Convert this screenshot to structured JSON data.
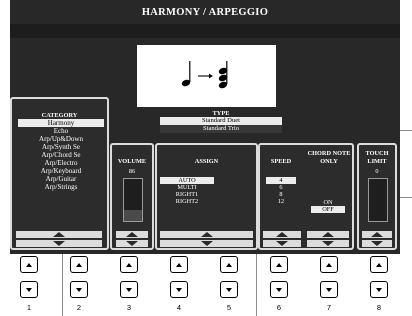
{
  "screen": {
    "title": "HARMONY / ARPEGGIO"
  },
  "category": {
    "header": "CATEGORY",
    "items": [
      {
        "label": "Harmony",
        "selected": true
      },
      {
        "label": "Echo",
        "selected": false
      },
      {
        "label": "Arp/Up&Down",
        "selected": false
      },
      {
        "label": "Arp/Synth Se",
        "selected": false
      },
      {
        "label": "Arp/Chord Se",
        "selected": false
      },
      {
        "label": "Arp/Electro",
        "selected": false
      },
      {
        "label": "Arp/Keyboard",
        "selected": false
      },
      {
        "label": "Arp/Guitar",
        "selected": false
      },
      {
        "label": "Arp/Strings",
        "selected": false
      }
    ]
  },
  "type": {
    "header": "TYPE",
    "items": [
      {
        "label": "Standard Duet",
        "selected": true
      },
      {
        "label": "Standard Trio",
        "selected": false
      }
    ]
  },
  "volume": {
    "header": "VOLUME",
    "value": "86",
    "level": 0.27
  },
  "assign": {
    "header": "ASSIGN",
    "options": [
      {
        "label": "AUTO",
        "selected": true
      },
      {
        "label": "MULTI",
        "selected": false
      },
      {
        "label": "RIGHT1",
        "selected": false
      },
      {
        "label": "RIGHT2",
        "selected": false
      }
    ]
  },
  "speed": {
    "header": "SPEED",
    "options": [
      {
        "label": "4",
        "selected": true
      },
      {
        "label": "6",
        "selected": false
      },
      {
        "label": "8",
        "selected": false
      },
      {
        "label": "12",
        "selected": false
      }
    ]
  },
  "chord_note_only": {
    "header_line1": "CHORD NOTE",
    "header_line2": "ONLY",
    "options": [
      {
        "label": "ON",
        "selected": false
      },
      {
        "label": "OFF",
        "selected": true
      }
    ]
  },
  "touch_limit": {
    "header_line1": "TOUCH",
    "header_line2": "LIMIT",
    "value": "0",
    "level": 0.0
  },
  "buttons": [
    "1",
    "2",
    "3",
    "4",
    "5",
    "6",
    "7",
    "8"
  ],
  "icons": {
    "note_change": "quarter-note-to-chord-icon",
    "up": "triangle-up-icon",
    "down": "triangle-down-icon"
  },
  "colors": {
    "screen_bg": "#282828",
    "panel_border": "#dcdcdc",
    "selection": "#ececec"
  }
}
